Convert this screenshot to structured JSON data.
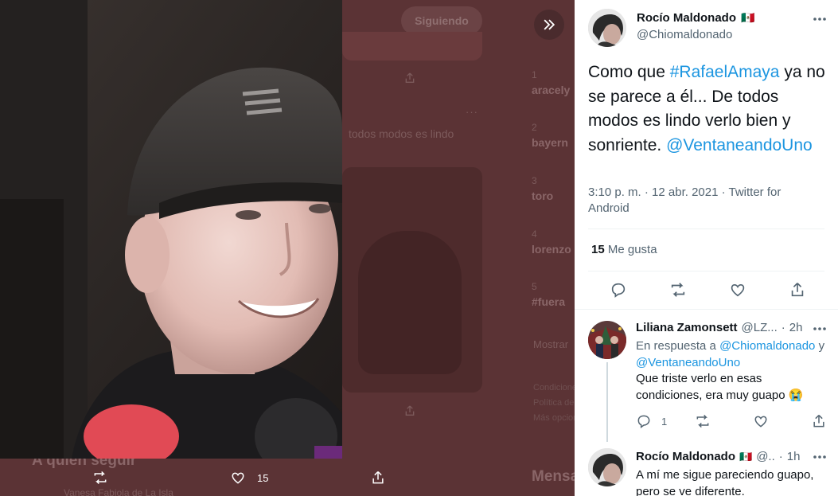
{
  "background": {
    "follow_button": "Siguiendo",
    "tweet_text": "todos modos es lindo",
    "trends": [
      {
        "rank": "1",
        "name": "aracely"
      },
      {
        "rank": "2",
        "name": "bayern"
      },
      {
        "rank": "3",
        "name": "toro"
      },
      {
        "rank": "4",
        "name": "lorenzo"
      },
      {
        "rank": "5",
        "name": "#fuera"
      }
    ],
    "show_more": "Mostrar",
    "footer_links": [
      "Condiciones",
      "Política de",
      "Más opciones"
    ],
    "who_to_follow": "A quién seguir",
    "who_item": "Vanesa Fabiola de La Isla",
    "messages": "Mensajes"
  },
  "media_actions": {
    "retweet_icon": "retweet-icon",
    "like_icon": "heart-icon",
    "like_count": "15",
    "share_icon": "share-icon"
  },
  "main_tweet": {
    "author_name": "Rocío Maldonado",
    "author_flag": "🇲🇽",
    "author_handle": "@Chiomaldonado",
    "text_before": "Como que ",
    "hashtag": "#RafaelAmaya",
    "text_after": " ya no se parece a él... De todos modos es lindo verlo bien y sonriente. ",
    "mention": "@VentaneandoUno",
    "time": "3:10 p. m. · 12 abr. 2021 · Twitter for Android",
    "likes_count": "15",
    "likes_label": "Me gusta"
  },
  "replies": [
    {
      "author_name": "Liliana Zamonsett",
      "author_handle": "@LZ...",
      "time": "2h",
      "replying_prefix": "En respuesta a",
      "replying_to_1": "@Chiomaldonado",
      "replying_and": "y",
      "replying_to_2": "@VentaneandoUno",
      "text": "Que triste verlo en esas condiciones, era muy guapo 😭",
      "reply_count": "1"
    },
    {
      "author_name": "Rocío Maldonado",
      "author_flag": "🇲🇽",
      "author_handle": "@..",
      "time": "1h",
      "text": "A mí me sigue pareciendo guapo, pero se ve diferente."
    }
  ],
  "colors": {
    "accent": "#1b95e0",
    "overlay": "#5b3335",
    "text": "#0f1419",
    "muted": "#536471"
  }
}
